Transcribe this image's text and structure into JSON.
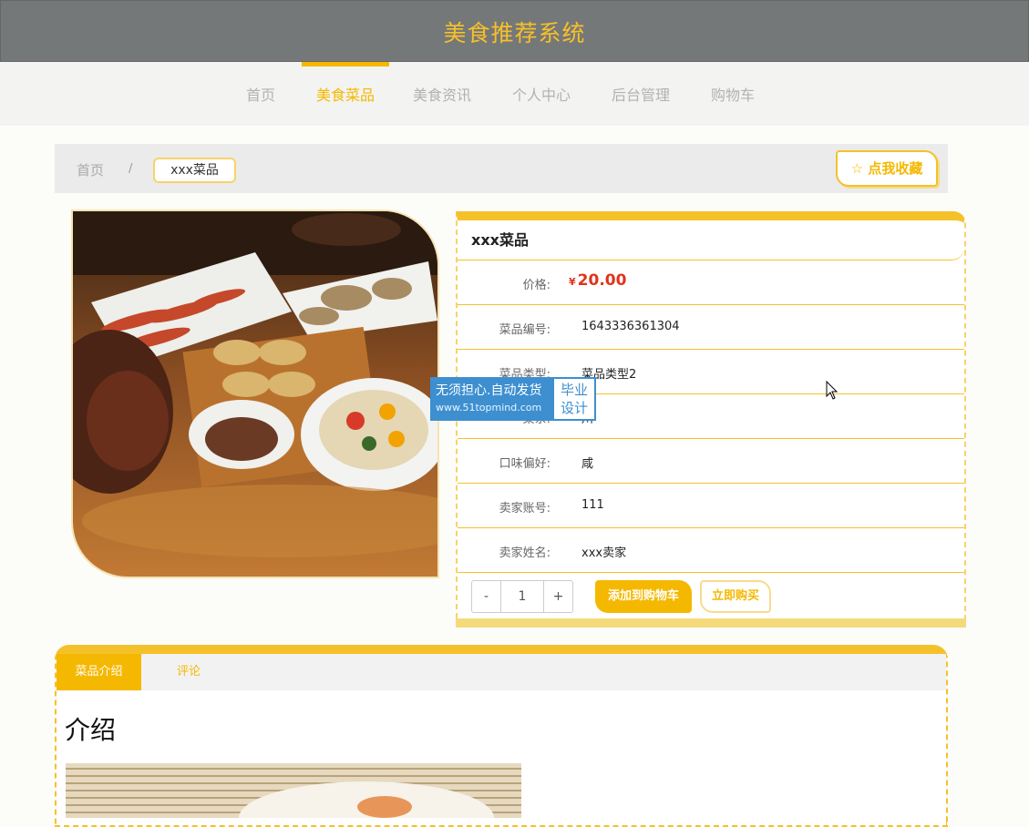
{
  "app": {
    "title": "美食推荐系统"
  },
  "nav": {
    "items": [
      {
        "label": "首页",
        "active": false
      },
      {
        "label": "美食菜品",
        "active": true
      },
      {
        "label": "美食资讯",
        "active": false
      },
      {
        "label": "个人中心",
        "active": false
      },
      {
        "label": "后台管理",
        "active": false
      },
      {
        "label": "购物车",
        "active": false
      }
    ]
  },
  "breadcrumb": {
    "home": "首页",
    "separator": "/",
    "current": "xxx菜品"
  },
  "favorite": {
    "label": "点我收藏",
    "icon": "star-outline-icon"
  },
  "watermark": {
    "line1": "无须担心.自动发货",
    "line2": "www.51topmind.com",
    "right1": "毕业",
    "right2": "设计"
  },
  "product": {
    "name": "xxx菜品",
    "price_label": "价格:",
    "currency": "¥",
    "price": "20.00",
    "fields": [
      {
        "label": "菜品编号:",
        "value": "1643336361304"
      },
      {
        "label": "菜品类型:",
        "value": "菜品类型2"
      },
      {
        "label": "菜系:",
        "value": "川"
      },
      {
        "label": "口味偏好:",
        "value": "咸"
      },
      {
        "label": "卖家账号:",
        "value": "111"
      },
      {
        "label": "卖家姓名:",
        "value": "xxx卖家"
      }
    ]
  },
  "purchase": {
    "minus": "-",
    "quantity": "1",
    "plus": "+",
    "add_to_cart": "添加到购物车",
    "buy_now": "立即购买"
  },
  "tabs": {
    "items": [
      {
        "label": "菜品介绍",
        "active": true
      },
      {
        "label": "评论",
        "active": false
      }
    ]
  },
  "intro": {
    "heading": "介绍"
  },
  "colors": {
    "accent": "#f5b800",
    "topbar": "#757878",
    "price": "#e0341c"
  }
}
